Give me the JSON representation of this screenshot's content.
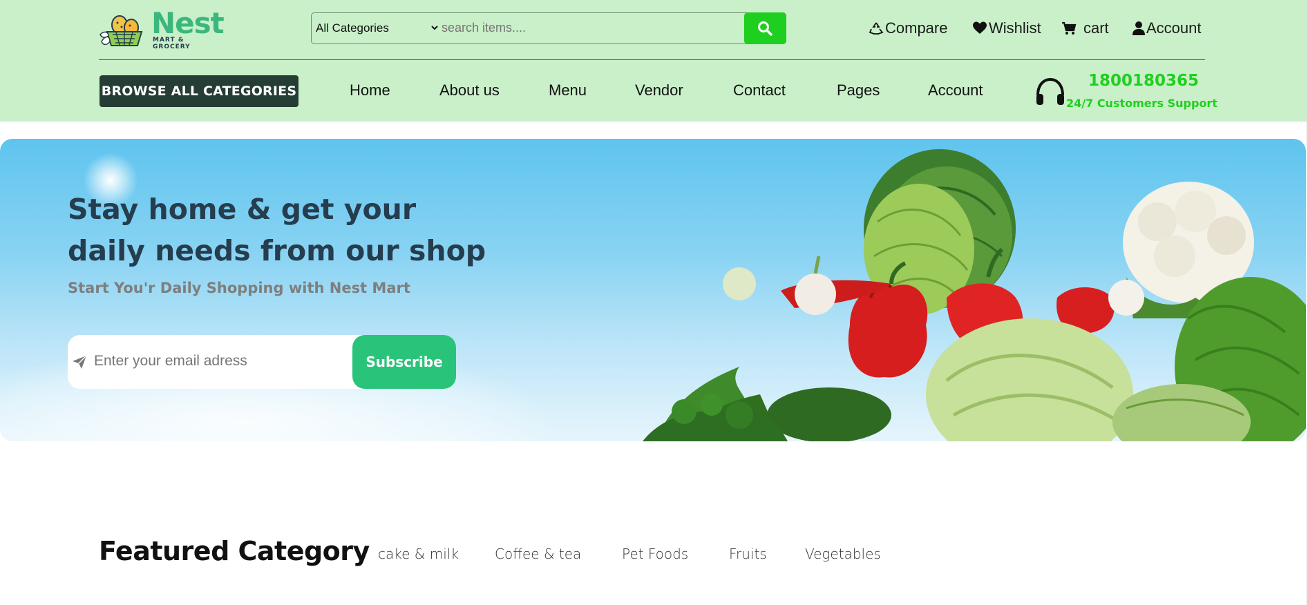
{
  "header": {
    "logo": {
      "name": "Nest",
      "tagline": "MART & GROCERY"
    },
    "search": {
      "category": "All Categories",
      "placeholder": "search items...."
    },
    "links": [
      {
        "label": "Compare",
        "icon": "recycle-icon"
      },
      {
        "label": "Wishlist",
        "icon": "heart-icon"
      },
      {
        "label": "cart",
        "icon": "cart-icon"
      },
      {
        "label": "Account",
        "icon": "user-icon"
      }
    ],
    "browse_label": "BROWSE ALL CATEGORIES",
    "nav": [
      "Home",
      "About us",
      "Menu",
      "Vendor",
      "Contact",
      "Pages",
      "Account"
    ],
    "support": {
      "phone": "1800180365",
      "text": "24/7 Customers Support",
      "icon": "headphones-icon"
    }
  },
  "hero": {
    "title_line1": "Stay home & get your",
    "title_line2": "daily needs from our shop",
    "subtitle": "Start You'r Daily Shopping with Nest Mart",
    "email_placeholder": "Enter your email adress",
    "subscribe_label": "Subscribe"
  },
  "featured": {
    "title": "Featured Category",
    "tabs": [
      "cake & milk",
      "Coffee & tea",
      "Pet Foods",
      "Fruits",
      "Vegetables"
    ]
  },
  "colors": {
    "header_bg": "#c9f0c8",
    "brand_green": "#3bb77e",
    "accent_green": "#1fcf1f",
    "browse_bg": "#253d35",
    "subscribe_bg": "#29c47a",
    "heading_dark": "#253d4e"
  }
}
